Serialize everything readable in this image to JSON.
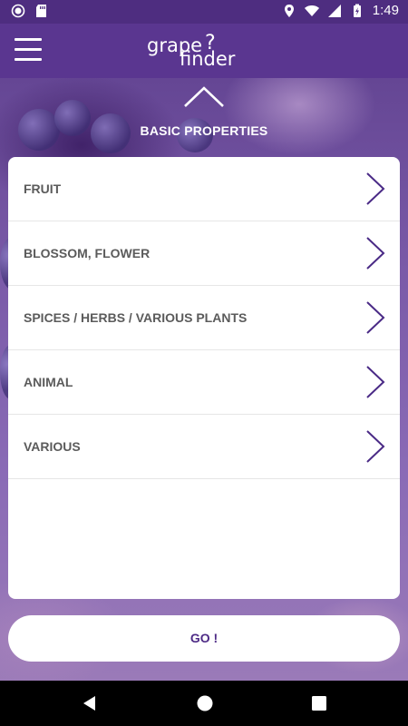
{
  "status_bar": {
    "time": "1:49",
    "icons": [
      "circle-notification-icon",
      "sd-card-icon",
      "location-pin-icon",
      "wifi-icon",
      "cellular-signal-icon",
      "battery-charging-icon"
    ]
  },
  "app_bar": {
    "menu_icon": "hamburger-menu-icon",
    "logo_line1": "grape",
    "logo_line2": "finder",
    "logo_mark": "?"
  },
  "section": {
    "collapse_icon": "chevron-up-icon",
    "title": "BASIC PROPERTIES"
  },
  "list": {
    "items": [
      {
        "label": "FRUIT",
        "icon": "chevron-right-icon"
      },
      {
        "label": "BLOSSOM, FLOWER",
        "icon": "chevron-right-icon"
      },
      {
        "label": "SPICES / HERBS / VARIOUS PLANTS",
        "icon": "chevron-right-icon"
      },
      {
        "label": "ANIMAL",
        "icon": "chevron-right-icon"
      },
      {
        "label": "VARIOUS",
        "icon": "chevron-right-icon"
      }
    ]
  },
  "actions": {
    "go_label": "GO !"
  },
  "nav_bar": {
    "icons": [
      "back-icon",
      "home-icon",
      "recents-icon"
    ]
  },
  "colors": {
    "brand_purple": "#5a3690",
    "status_bar": "#4e2d80",
    "accent_chevron": "#4a2a86",
    "list_text": "#5b5b5b"
  }
}
